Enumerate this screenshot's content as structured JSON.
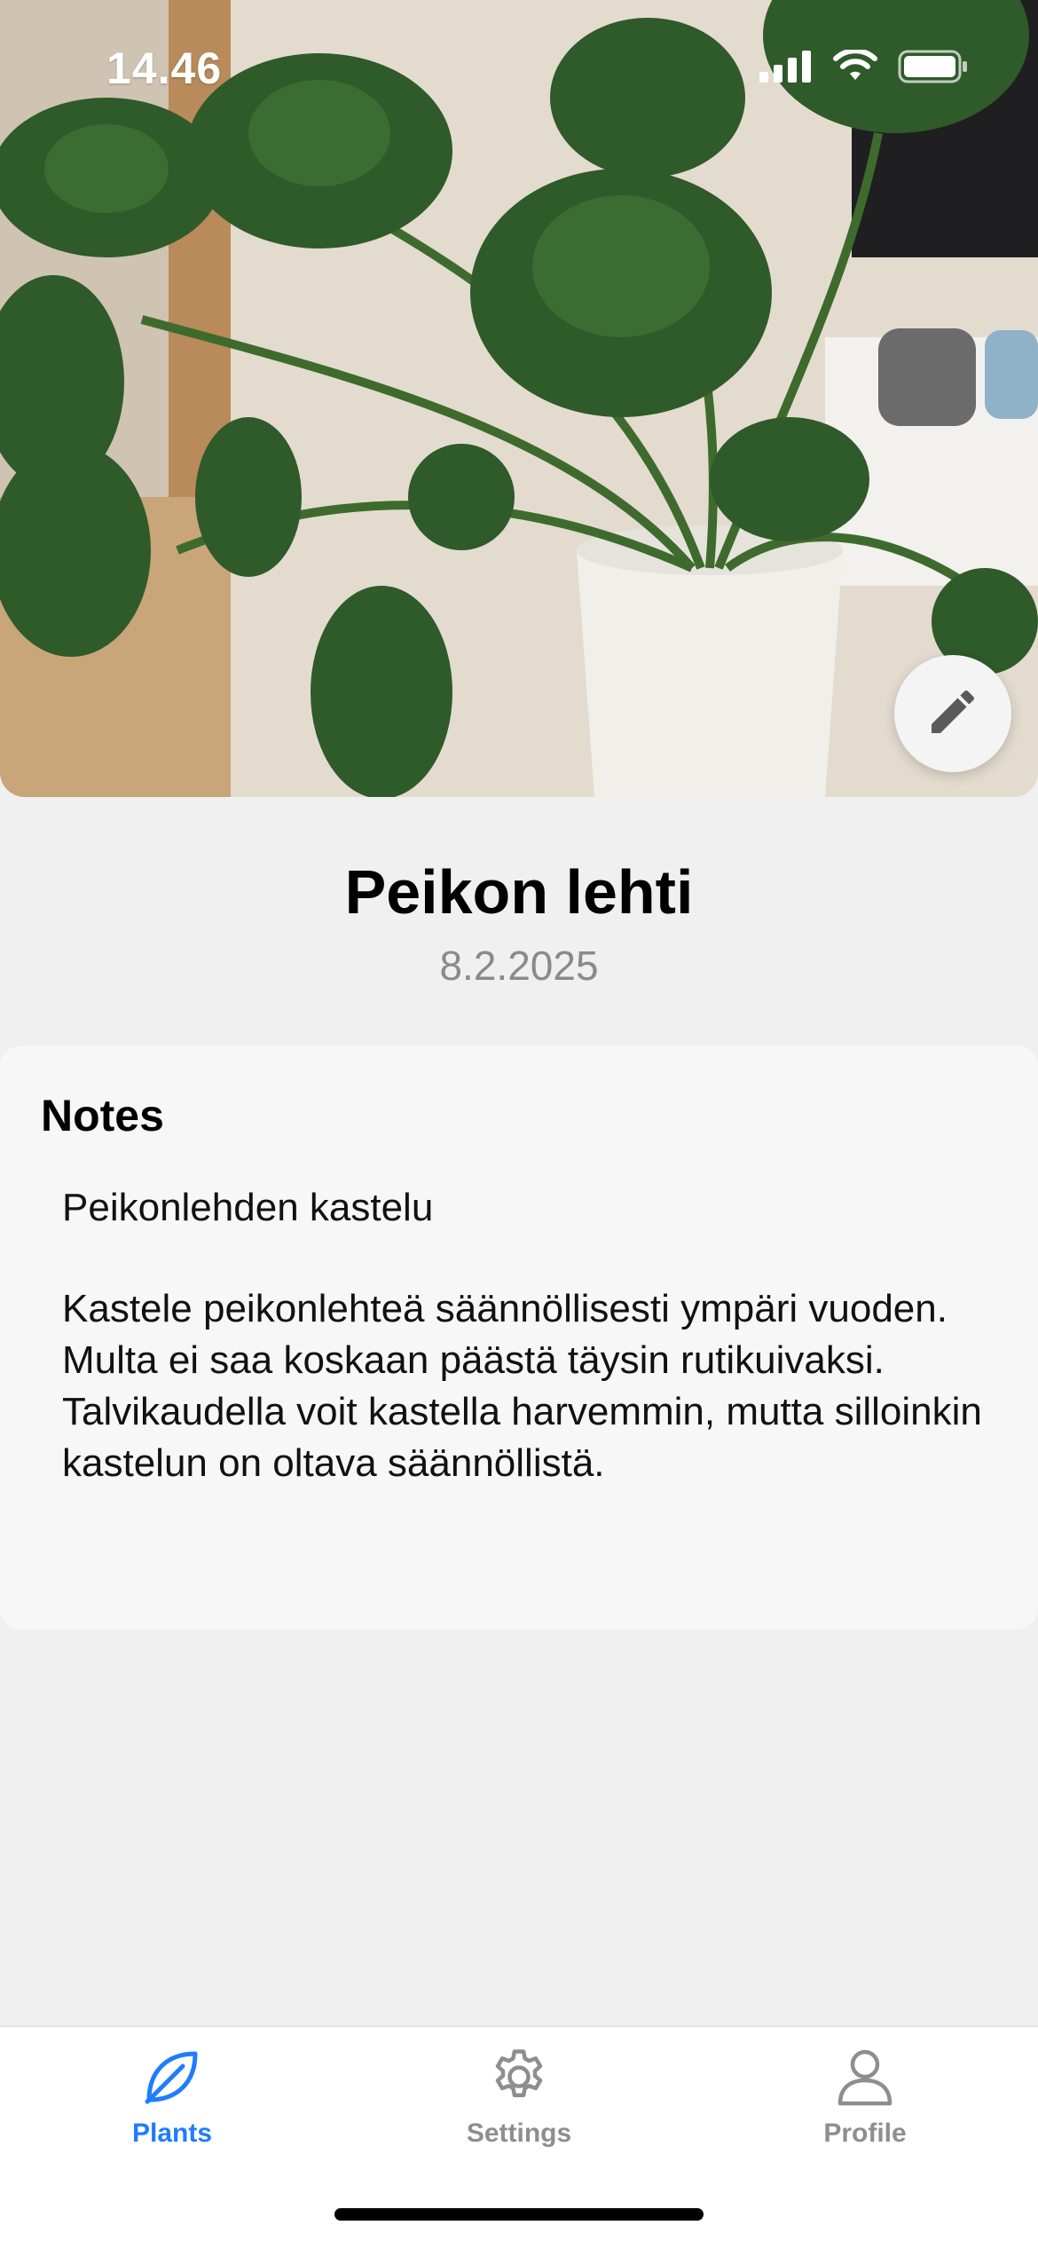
{
  "status_bar": {
    "time": "14.46"
  },
  "plant": {
    "name": "Peikon lehti",
    "date": "8.2.2025"
  },
  "notes": {
    "heading": "Notes",
    "title": "Peikonlehden kastelu",
    "body": "Kastele peikonlehteä säännöllisesti ympäri vuoden. Multa ei saa koskaan päästä täysin rutikuivaksi. Talvikaudella voit kastella harvemmin, mutta silloinkin kastelun on oltava säännöllistä."
  },
  "tab_bar": {
    "items": [
      {
        "label": "Plants",
        "icon": "leaf-icon",
        "active": true
      },
      {
        "label": "Settings",
        "icon": "gear-icon",
        "active": false
      },
      {
        "label": "Profile",
        "icon": "person-icon",
        "active": false
      }
    ]
  },
  "colors": {
    "accent": "#1f7cff",
    "inactive": "#8e8e8e",
    "background": "#f0f0f0",
    "card": "#f7f7f7"
  },
  "icons": {
    "edit": "pencil-icon",
    "signal": "cellular-signal-icon",
    "wifi": "wifi-icon",
    "battery": "battery-icon"
  }
}
